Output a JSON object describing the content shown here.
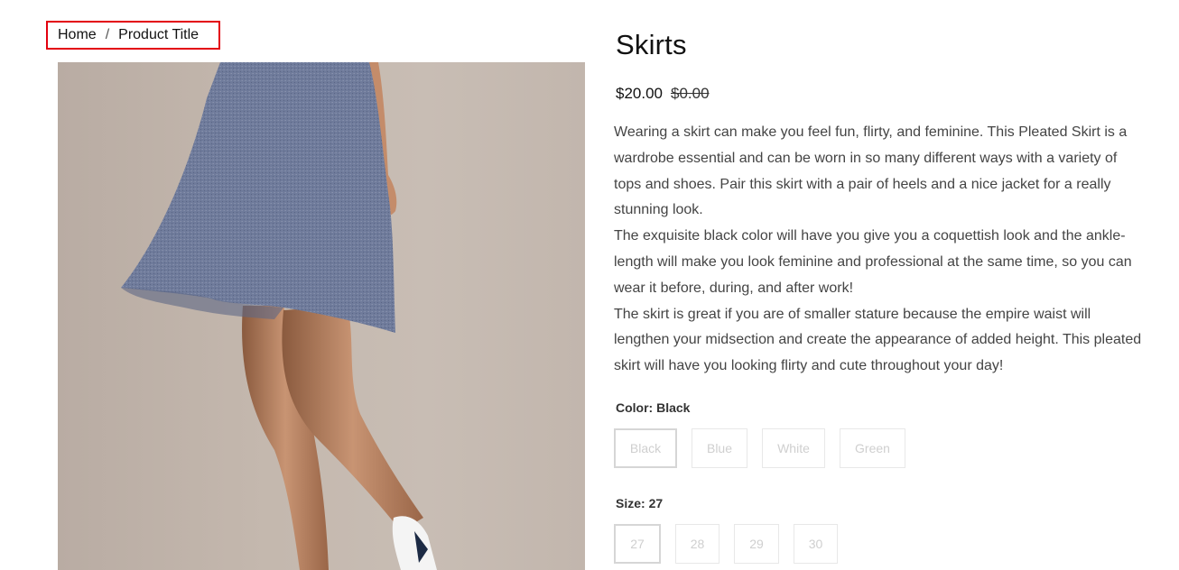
{
  "breadcrumb": {
    "home": "Home",
    "separator": "/",
    "current": "Product Title"
  },
  "product": {
    "title": "Skirts",
    "price": "$20.00",
    "compare_price": "$0.00",
    "description": [
      "Wearing a skirt can make you feel fun, flirty, and feminine. This Pleated Skirt is a wardrobe essential and can be worn in so many different ways with a variety of tops and shoes. Pair this skirt with a pair of heels and a nice jacket for a really stunning look.",
      "The exquisite black color will have you give you a coquettish look and the ankle-length will make you look feminine and professional at the same time, so you can wear it before, during, and after work!",
      "The skirt is great if you are of smaller stature because the empire waist will lengthen your midsection and create the appearance of added height. This pleated skirt will have you looking flirty and cute throughout your day!"
    ]
  },
  "options": {
    "color": {
      "label": "Color:",
      "selected": "Black",
      "values": [
        "Black",
        "Blue",
        "White",
        "Green"
      ]
    },
    "size": {
      "label": "Size:",
      "selected": "27",
      "values": [
        "27",
        "28",
        "29",
        "30"
      ]
    }
  },
  "colors": {
    "breadcrumb_highlight": "#e3000f",
    "skirt": "#6e7a9a",
    "background": "#c2b6ad"
  }
}
